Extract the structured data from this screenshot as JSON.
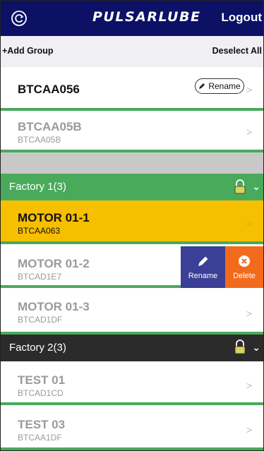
{
  "header": {
    "logo": "PULSARLUBE",
    "logout": "Logout"
  },
  "toolbar": {
    "add_group": "+Add Group",
    "deselect_all": "Deselect All"
  },
  "devices": [
    {
      "name": "BTCAA056",
      "sub": "",
      "rename": "Rename"
    },
    {
      "name": "BTCAA05B",
      "sub": "BTCAA05B"
    }
  ],
  "groups": [
    {
      "title": "Factory 1(3)",
      "color": "#4aaa5c",
      "items": [
        {
          "name": "MOTOR 01-1",
          "sub": "BTCAA063"
        },
        {
          "name": "MOTOR 01-2",
          "sub": "BTCAD1E7"
        },
        {
          "name": "MOTOR 01-3",
          "sub": "BTCAD1DF"
        }
      ]
    },
    {
      "title": "Factory 2(3)",
      "color": "#2b2b2b",
      "items": [
        {
          "name": "TEST 01",
          "sub": "BTCAD1CD"
        },
        {
          "name": "TEST 03",
          "sub": "BTCAA1DF"
        }
      ]
    }
  ],
  "swipe_actions": {
    "rename": "Rename",
    "delete": "Delete"
  },
  "colors": {
    "header": "#0c1166",
    "selected": "#f6bf00",
    "rename_action": "#3b3f96",
    "delete_action": "#f26b1d"
  }
}
